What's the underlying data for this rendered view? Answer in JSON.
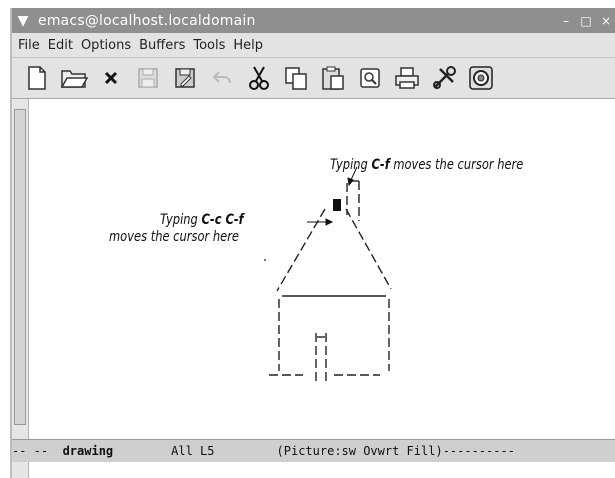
{
  "window": {
    "title": "emacs@localhost.localdomain",
    "buttons": [
      "minimize",
      "maximize",
      "close"
    ]
  },
  "menubar": {
    "items": [
      "File",
      "Edit",
      "Options",
      "Buffers",
      "Tools",
      "Help"
    ]
  },
  "toolbar": {
    "icons": [
      "new-file-icon",
      "open-folder-icon",
      "close-x-icon",
      "save-icon",
      "save-as-icon",
      "undo-icon",
      "cut-icon",
      "copy-icon",
      "paste-icon",
      "search-icon",
      "print-icon",
      "customize-icon",
      "help-icon"
    ]
  },
  "annotations": {
    "cf_text": "moves the cursor here",
    "cf_prefix": "Typing ",
    "cf_key": "C-f",
    "ccf_prefix": "Typing ",
    "ccf_key": "C-c C-f",
    "ccf_line2": "moves the cursor here"
  },
  "modeline": {
    "prefix": "-- --  ",
    "buffer": "drawing",
    "position": "All L5",
    "modes": "(Picture:sw Ovwrt Fill)",
    "fill": "----------"
  },
  "colors": {
    "titlebar": "#8f8f8f",
    "menubar": "#e3e3e3",
    "modeline": "#cfcfcf"
  }
}
